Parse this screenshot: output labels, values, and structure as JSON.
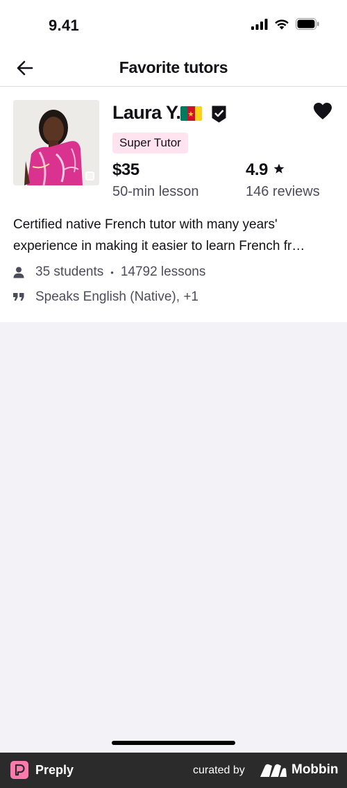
{
  "status_bar": {
    "time": "9.41",
    "icons": [
      "signal-icon",
      "wifi-icon",
      "battery-icon"
    ]
  },
  "nav": {
    "title": "Favorite tutors",
    "back_icon": "back-arrow-icon"
  },
  "tutor": {
    "name": "Laura Y.",
    "flag": "cameroon-flag-icon",
    "verified_icon": "verified-shield-icon",
    "favorite_icon": "heart-icon",
    "badge": "Super Tutor",
    "price": "$35",
    "price_sub": "50-min lesson",
    "rating": "4.9",
    "rating_icon": "star-icon",
    "reviews": "146 reviews",
    "description": "Certified native French tutor with many years' experience in making it easier to learn French fr…",
    "students": "35 students",
    "separator": "•",
    "lessons": "14792 lessons",
    "speaks": "Speaks English (Native), +1"
  },
  "footer": {
    "brand": "Preply",
    "curated_by": "curated by",
    "mobbin": "Mobbin"
  },
  "colors": {
    "badge_bg": "#ffe4ef",
    "page_bg": "#f3f2f7",
    "footer_bg": "#2b2b2b",
    "preply_pink": "#ff7aac"
  }
}
